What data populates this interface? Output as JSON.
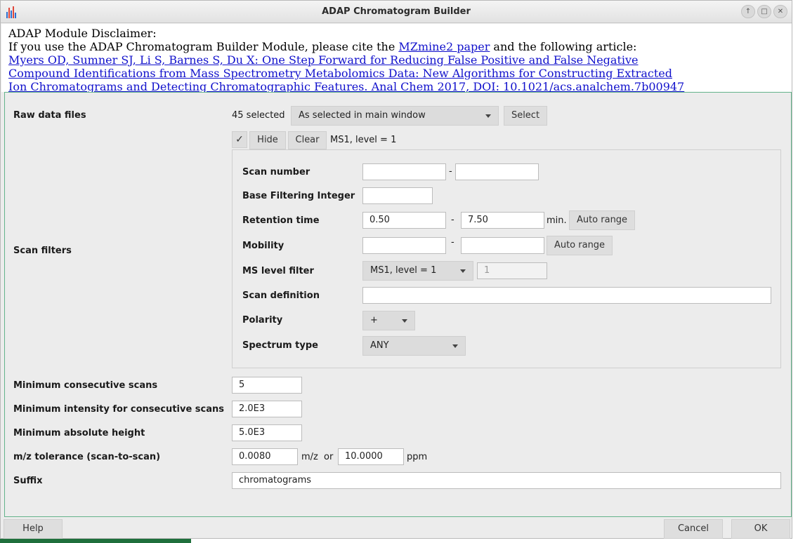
{
  "window": {
    "title": "ADAP Chromatogram Builder",
    "controls": [
      "↑",
      "□",
      "✕"
    ]
  },
  "disclaimer": {
    "heading": "ADAP Module Disclaimer:",
    "line2_prefix": "If you use the ADAP Chromatogram Builder Module, please cite the ",
    "mzmine_link": "MZmine2 paper",
    "line2_suffix": " and the following article:",
    "article_line1": "Myers OD, Sumner SJ, Li S, Barnes S, Du X: One Step Forward for Reducing False Positive and False Negative",
    "article_line2": "Compound Identifications from Mass Spectrometry Metabolomics Data: New Algorithms for Constructing Extracted",
    "article_line3": "Ion Chromatograms and Detecting Chromatographic Features. Anal Chem 2017, DOI: 10.1021/acs.analchem.7b00947"
  },
  "raw_data": {
    "label": "Raw data files",
    "selected_count": "45 selected",
    "mode": "As selected in main window",
    "select_button": "Select"
  },
  "scan_filters": {
    "label": "Scan filters",
    "checkbox_mark": "✓",
    "hide_button": "Hide",
    "clear_button": "Clear",
    "summary": "MS1, level = 1",
    "scan_number": {
      "label": "Scan number",
      "from": "",
      "to": "",
      "dash": "-"
    },
    "base_filtering": {
      "label": "Base Filtering Integer",
      "value": ""
    },
    "retention_time": {
      "label": "Retention time",
      "from": "0.50",
      "to": "7.50",
      "dash": "-",
      "unit": "min.",
      "auto_button": "Auto range"
    },
    "mobility": {
      "label": "Mobility",
      "from": "",
      "to": "",
      "dash": "-",
      "auto_button": "Auto range"
    },
    "ms_level": {
      "label": "MS level filter",
      "selected": "MS1, level = 1",
      "value": "1"
    },
    "scan_definition": {
      "label": "Scan definition",
      "value": ""
    },
    "polarity": {
      "label": "Polarity",
      "selected": "+"
    },
    "spectrum_type": {
      "label": "Spectrum type",
      "selected": "ANY"
    }
  },
  "params": {
    "min_consecutive": {
      "label": "Minimum consecutive scans",
      "value": "5"
    },
    "min_intensity": {
      "label": "Minimum intensity for consecutive scans",
      "value": "2.0E3"
    },
    "min_abs_height": {
      "label": "Minimum absolute height",
      "value": "5.0E3"
    },
    "mz_tolerance": {
      "label": "m/z tolerance (scan-to-scan)",
      "mz_value": "0.0080",
      "mz_unit": "m/z",
      "or": "or",
      "ppm_value": "10.0000",
      "ppm_unit": "ppm"
    },
    "suffix": {
      "label": "Suffix",
      "value": "chromatograms"
    }
  },
  "footer": {
    "help": "Help",
    "cancel": "Cancel",
    "ok": "OK"
  }
}
